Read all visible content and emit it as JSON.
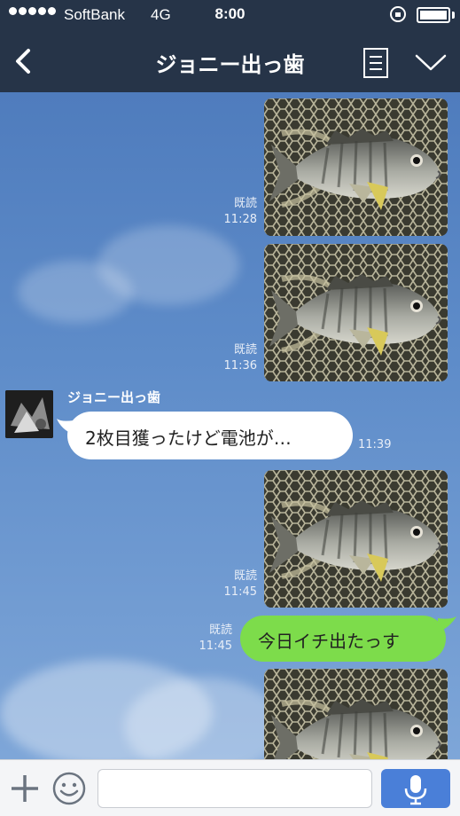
{
  "status_bar": {
    "carrier": "SoftBank",
    "network": "4G",
    "time": "8:00"
  },
  "header": {
    "title": "ジョニー出っ歯"
  },
  "messages": [
    {
      "type": "image",
      "read_label": "既読",
      "time": "11:28"
    },
    {
      "type": "image",
      "read_label": "既読",
      "time": "11:36"
    },
    {
      "type": "text",
      "sender": "ジョニー出っ歯",
      "text": "2枚目獲ったけど電池が…",
      "time": "11:39"
    },
    {
      "type": "image",
      "read_label": "既読",
      "time": "11:45"
    },
    {
      "type": "text",
      "read_label": "既読",
      "text": "今日イチ出たっす",
      "time": "11:45"
    },
    {
      "type": "image"
    }
  ],
  "input": {
    "value": "",
    "placeholder": ""
  },
  "colors": {
    "header_bg": "#263448",
    "chat_bg": "#5b86c2",
    "outgoing_bubble": "#7ddc4b",
    "incoming_bubble": "#ffffff",
    "mic_button": "#4a7fd8"
  }
}
